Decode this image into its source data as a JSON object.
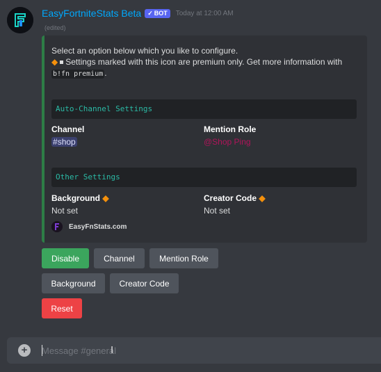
{
  "message": {
    "username": "EasyFortniteStats Beta",
    "bot_badge": "BOT",
    "timestamp": "Today at 12:00 AM",
    "edited": "(edited)"
  },
  "embed": {
    "accent_color": "#2d7d46",
    "description_line1": "Select an option below which you like to configure.",
    "premium_note_a": "Settings marked with this icon are premium only. Get more information with",
    "premium_command": "b!fn premium",
    "premium_note_end": ".",
    "section1_title": "Auto-Channel Settings",
    "fields1": {
      "channel_name": "Channel",
      "channel_value": "shop",
      "mention_role_name": "Mention Role",
      "mention_role_value": "@Shop Ping"
    },
    "section2_title": "Other Settings",
    "fields2": {
      "background_name": "Background",
      "background_value": "Not set",
      "creator_code_name": "Creator Code",
      "creator_code_value": "Not set"
    },
    "footer_text": "EasyFnStats.com"
  },
  "buttons": {
    "disable": "Disable",
    "channel": "Channel",
    "mention_role": "Mention Role",
    "background": "Background",
    "creator_code": "Creator Code",
    "reset": "Reset"
  },
  "composer": {
    "placeholder": "Message #general"
  },
  "colors": {
    "success": "#3ba55d",
    "secondary": "#4f545c",
    "danger": "#ed4245",
    "bot_badge": "#5865f2",
    "username": "#00a8fc",
    "premium_diamond": "#f4900c"
  }
}
